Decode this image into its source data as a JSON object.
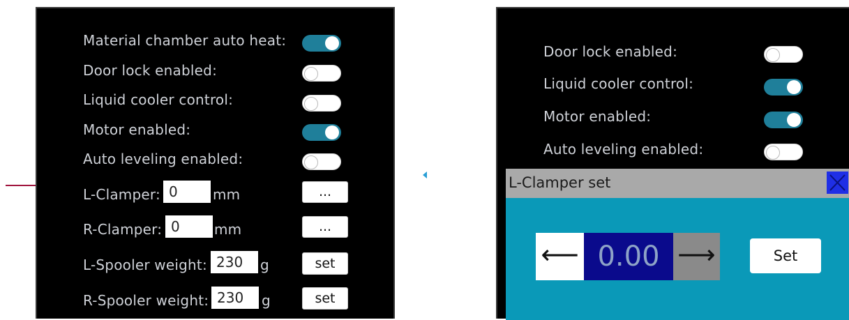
{
  "left_panel": {
    "rows": [
      {
        "label": "Material chamber auto heat:",
        "toggle": "on"
      },
      {
        "label": "Door lock enabled:",
        "toggle": "off"
      },
      {
        "label": "Liquid cooler control:",
        "toggle": "off"
      },
      {
        "label": "Motor enabled:",
        "toggle": "on"
      },
      {
        "label": "Auto leveling enabled:",
        "toggle": "off"
      }
    ],
    "l_clamper": {
      "label": "L-Clamper:",
      "value": "0",
      "unit": "mm",
      "button": "..."
    },
    "r_clamper": {
      "label": "R-Clamper:",
      "value": "0",
      "unit": "mm",
      "button": "..."
    },
    "l_spooler": {
      "label": "L-Spooler weight:",
      "value": "230",
      "unit": "g",
      "button": "set"
    },
    "r_spooler": {
      "label": "R-Spooler weight:",
      "value": "230",
      "unit": "g",
      "button": "set"
    }
  },
  "right_panel": {
    "rows": [
      {
        "label": "Door lock enabled:",
        "toggle": "off"
      },
      {
        "label": "Liquid cooler control:",
        "toggle": "on"
      },
      {
        "label": "Motor enabled:",
        "toggle": "on"
      },
      {
        "label": "Auto leveling enabled:",
        "toggle": "off"
      }
    ],
    "dialog": {
      "title": "L-Clamper set",
      "decrement": "⟵",
      "value": "0.00",
      "increment": "⟶",
      "set_label": "Set"
    }
  },
  "colors": {
    "toggle_on": "#1f7f9a",
    "dialog_body": "#0a99b8",
    "value_bg": "#0a0a8c",
    "close_button": "#1f2fe6",
    "annotation_arrow": "#a0153e"
  }
}
